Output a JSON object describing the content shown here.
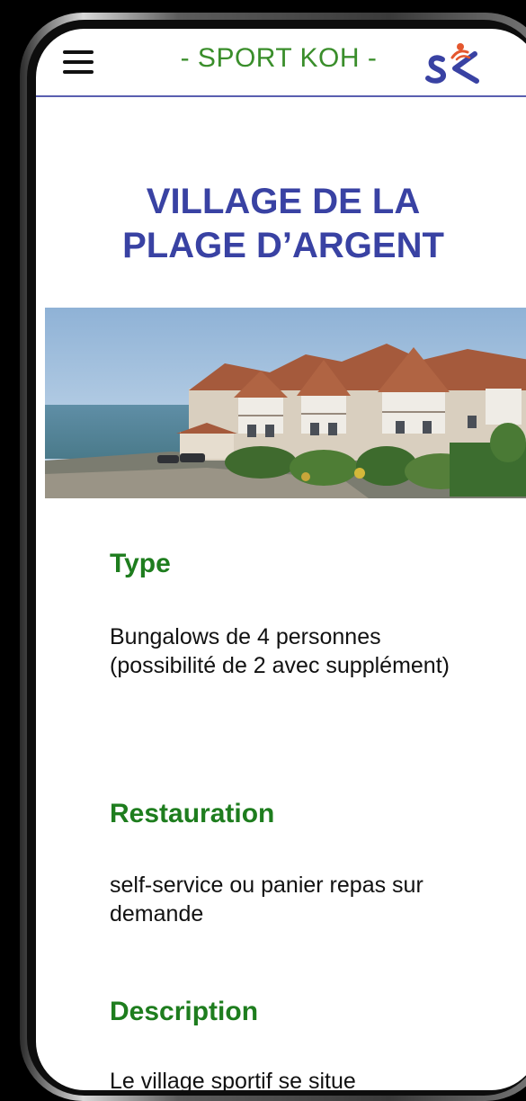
{
  "header": {
    "brand_title": "- SPORT KOH -",
    "logo_text": "SK"
  },
  "page": {
    "title_line1": "VILLAGE DE LA",
    "title_line2": "PLAGE D’ARGENT"
  },
  "sections": [
    {
      "heading": "Type",
      "text": "Bungalows de 4 personnes (possibilité de 2 avec supplément)"
    },
    {
      "heading": "Restauration",
      "text": "self-service ou panier repas sur demande"
    },
    {
      "heading": "Description",
      "text": "Le village sportif se situe"
    }
  ],
  "colors": {
    "brand_green": "#3a8e2b",
    "title_blue": "#3942a3",
    "heading_green": "#1e7d1e",
    "header_rule": "#5a5fb0",
    "logo_red": "#e4572e"
  },
  "icons": {
    "menu": "hamburger-icon",
    "logo": "sk-logo"
  }
}
